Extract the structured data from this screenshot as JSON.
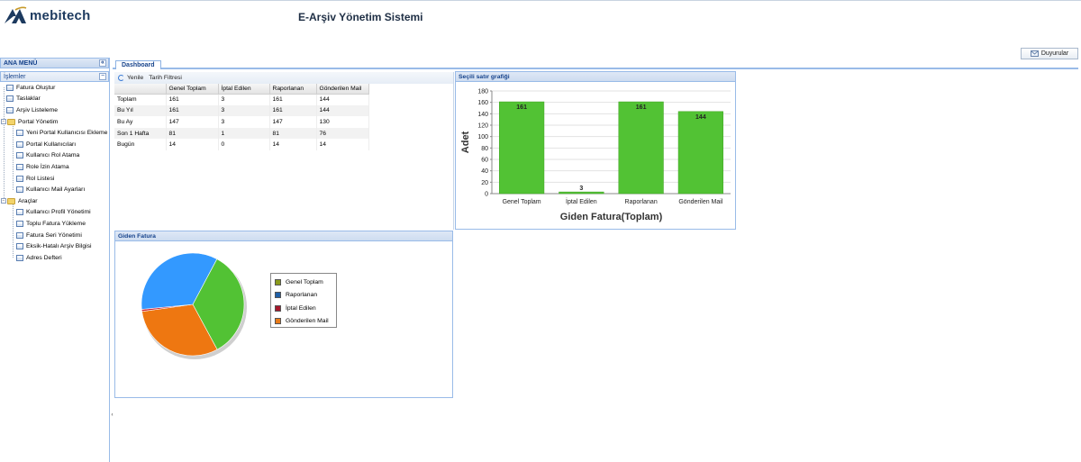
{
  "header": {
    "brand": "mebitech",
    "title": "E-Arşiv Yönetim Sistemi",
    "announcements_label": "Duyurular"
  },
  "sidebar": {
    "title": "ANA MENÜ",
    "collapse_glyph": "«",
    "section_title": "İşlemler",
    "section_toggle": "−",
    "items": [
      {
        "label": "Fatura Oluştur",
        "icon": "doc-icon"
      },
      {
        "label": "Taslaklar",
        "icon": "doc-icon"
      },
      {
        "label": "Arşiv Listeleme",
        "icon": "doc-icon"
      }
    ],
    "portal": {
      "label": "Portal Yönetim",
      "items": [
        "Yeni Portal Kullanıcısı Ekleme",
        "Portal Kullanıcıları",
        "Kullanıcı Rol Atama",
        "Role İzin Atama",
        "Rol Listesi",
        "Kullanıcı Mail Ayarları"
      ]
    },
    "tools": {
      "label": "Araçlar",
      "items": [
        "Kullanıcı Profil Yönetimi",
        "Toplu Fatura Yükleme",
        "Fatura Seri Yönetimi",
        "Eksik-Hatalı Arşiv Bilgisi",
        "Adres Defteri"
      ]
    }
  },
  "tabs": [
    {
      "label": "Dashboard",
      "active": true
    }
  ],
  "summary": {
    "toolbar": {
      "refresh": "Yenile",
      "date_filter": "Tarih Filtresi"
    },
    "columns": [
      "",
      "Genel Toplam",
      "İptal Edilen",
      "Raporlanan",
      "Gönderilen Mail"
    ],
    "rows": [
      [
        "Toplam",
        "161",
        "3",
        "161",
        "144"
      ],
      [
        "Bu Yıl",
        "161",
        "3",
        "161",
        "144"
      ],
      [
        "Bu Ay",
        "147",
        "3",
        "147",
        "130"
      ],
      [
        "Son 1 Hafta",
        "81",
        "1",
        "81",
        "76"
      ],
      [
        "Bugün",
        "14",
        "0",
        "14",
        "14"
      ]
    ]
  },
  "bar_panel": {
    "title": "Seçili satır grafiği"
  },
  "pie_panel": {
    "title": "Giden Fatura"
  },
  "chart_data": [
    {
      "type": "bar",
      "categories": [
        "Genel Toplam",
        "İptal Edilen",
        "Raporlanan",
        "Gönderilen Mail"
      ],
      "values": [
        161,
        3,
        161,
        144
      ],
      "xlabel": "Giden Fatura(Toplam)",
      "ylabel": "Adet",
      "ylim": [
        0,
        180
      ],
      "yticks": [
        0,
        20,
        40,
        60,
        80,
        100,
        120,
        140,
        160,
        180
      ],
      "bar_color": "#52c234",
      "grid": true
    },
    {
      "type": "pie",
      "labels": [
        "Genel Toplam",
        "Raporlanan",
        "İptal Edilen",
        "Gönderilen Mail"
      ],
      "legend_colors": [
        "#8a9a1b",
        "#1f5fa6",
        "#a5162a",
        "#e87b1a"
      ],
      "slice_colors": [
        "#52c234",
        "#3399ff",
        "#cc2233",
        "#ee7711"
      ],
      "values": [
        161,
        161,
        3,
        144
      ],
      "legend_position": "right"
    }
  ]
}
